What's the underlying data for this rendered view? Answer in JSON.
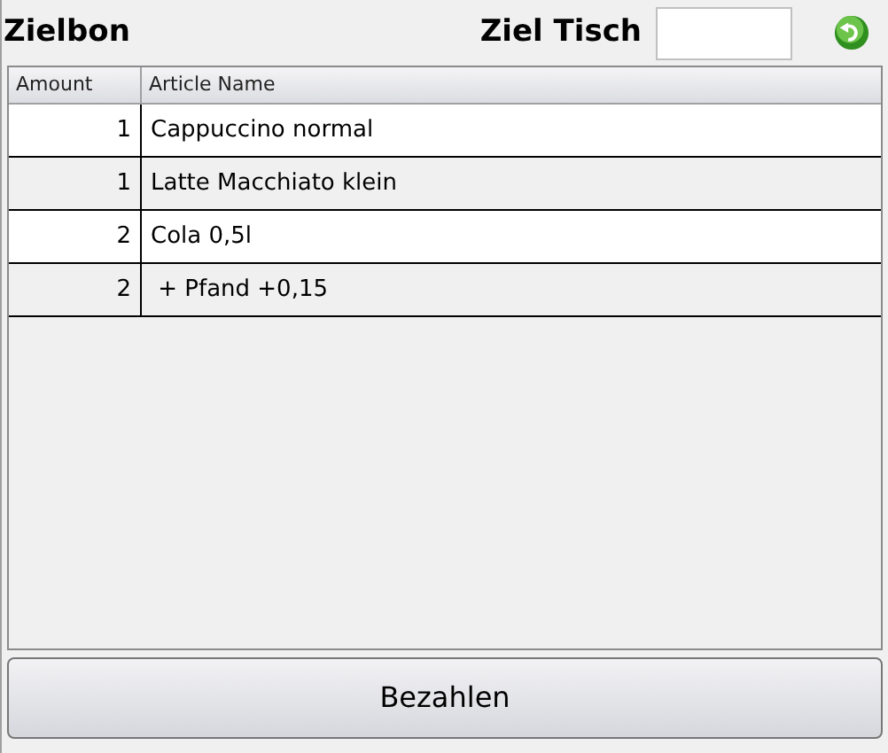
{
  "title": "Zielbon",
  "target_table": {
    "label": "Ziel Tisch"
  },
  "table": {
    "columns": [
      "Amount",
      "Article Name"
    ],
    "rows": [
      {
        "amount": "1",
        "article": "Cappuccino normal"
      },
      {
        "amount": "1",
        "article": "Latte Macchiato klein"
      },
      {
        "amount": "2",
        "article": "Cola 0,5l"
      },
      {
        "amount": "2",
        "article": " + Pfand +0,15"
      }
    ]
  },
  "pay_button": "Bezahlen"
}
